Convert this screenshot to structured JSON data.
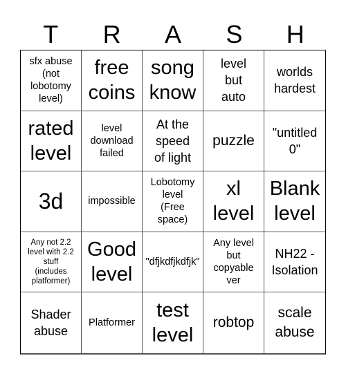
{
  "title_letters": [
    "T",
    "R",
    "A",
    "S",
    "H"
  ],
  "cells": [
    {
      "text": "sfx abuse (not lobotomy level)",
      "lines": [
        "sfx abuse",
        "(not",
        "lobotomy",
        "level)"
      ],
      "size": "sm"
    },
    {
      "text": "free coins",
      "lines": [
        "free",
        "coins"
      ],
      "size": "xl"
    },
    {
      "text": "song know",
      "lines": [
        "song",
        "know"
      ],
      "size": "xl"
    },
    {
      "text": "level but auto",
      "lines": [
        "level",
        "but",
        "auto"
      ],
      "size": "md"
    },
    {
      "text": "worlds hardest",
      "lines": [
        "worlds",
        "hardest"
      ],
      "size": "md"
    },
    {
      "text": "rated level",
      "lines": [
        "rated",
        "level"
      ],
      "size": "xl"
    },
    {
      "text": "level download failed",
      "lines": [
        "level",
        "download",
        "failed"
      ],
      "size": "sm"
    },
    {
      "text": "At the speed of light",
      "lines": [
        "At the",
        "speed",
        "of light"
      ],
      "size": "md"
    },
    {
      "text": "puzzle",
      "lines": [
        "puzzle"
      ],
      "size": "lg"
    },
    {
      "text": "\"untitled 0\"",
      "lines": [
        "\"untitled",
        "0\""
      ],
      "size": "md"
    },
    {
      "text": "3d",
      "lines": [
        "3d"
      ],
      "size": "xxl"
    },
    {
      "text": "impossible",
      "lines": [
        "impossible"
      ],
      "size": "sm"
    },
    {
      "text": "Lobotomy level (Free space)",
      "lines": [
        "Lobotomy",
        "level",
        "(Free",
        "space)"
      ],
      "size": "sm",
      "free_space": true
    },
    {
      "text": "xl level",
      "lines": [
        "xl",
        "level"
      ],
      "size": "xl"
    },
    {
      "text": "Blank level",
      "lines": [
        "Blank",
        "level"
      ],
      "size": "xl"
    },
    {
      "text": "Any not 2.2 level with 2.2 stuff (includes platformer)",
      "lines": [
        "Any not 2.2",
        "level with 2.2",
        "stuff",
        "(includes",
        "platformer)"
      ],
      "size": "xs"
    },
    {
      "text": "Good level",
      "lines": [
        "Good",
        "level"
      ],
      "size": "xl"
    },
    {
      "text": "\"dfjkdfjkdfjk\"",
      "lines": [
        "\"dfjkdfjkdfjk\""
      ],
      "size": "sm"
    },
    {
      "text": "Any level but copyable ver",
      "lines": [
        "Any level",
        "but",
        "copyable",
        "ver"
      ],
      "size": "sm"
    },
    {
      "text": "NH22 - Isolation",
      "lines": [
        "NH22 -",
        "Isolation"
      ],
      "size": "md"
    },
    {
      "text": "Shader abuse",
      "lines": [
        "Shader",
        "abuse"
      ],
      "size": "md"
    },
    {
      "text": "Platformer",
      "lines": [
        "Platformer"
      ],
      "size": "sm"
    },
    {
      "text": "test level",
      "lines": [
        "test",
        "level"
      ],
      "size": "xl"
    },
    {
      "text": "robtop",
      "lines": [
        "robtop"
      ],
      "size": "lg"
    },
    {
      "text": "scale abuse",
      "lines": [
        "scale",
        "abuse"
      ],
      "size": "lg"
    }
  ]
}
